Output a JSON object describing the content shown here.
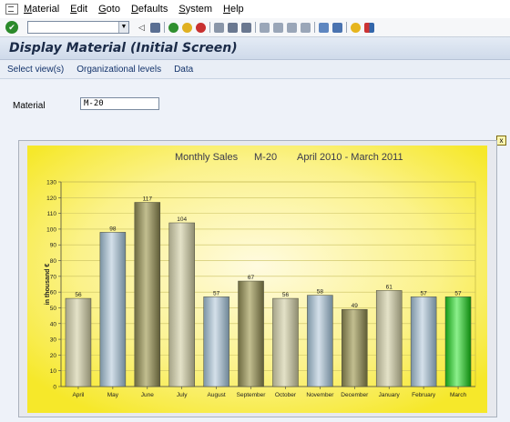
{
  "menu": {
    "items": [
      "Material",
      "Edit",
      "Goto",
      "Defaults",
      "System",
      "Help"
    ],
    "underlines": [
      "M",
      "E",
      "G",
      "D",
      "S",
      "H"
    ]
  },
  "toolbar": {
    "command_value": "",
    "icons": [
      "enter-icon",
      "back-icon",
      "exit-icon",
      "cancel-icon",
      "save-icon",
      "print-icon",
      "find-icon",
      "find-next-icon",
      "first-page-icon",
      "prev-page-icon",
      "next-page-icon",
      "last-page-icon",
      "create-session-icon",
      "shortcut-icon",
      "help-icon",
      "layout-icon"
    ]
  },
  "title": "Display Material (Initial Screen)",
  "appbar": {
    "select_views": "Select view(s)",
    "org_levels": "Organizational levels",
    "data": "Data"
  },
  "form": {
    "material_label": "Material",
    "material_value": "M-20"
  },
  "closebox": "x",
  "chart_data": {
    "type": "bar",
    "title_parts": [
      "Monthly Sales",
      "M-20",
      "April 2010 - March 2011"
    ],
    "ylabel": "in thousand €",
    "xlabel": "",
    "ylim": [
      0,
      130
    ],
    "yticks": [
      0,
      10,
      20,
      30,
      40,
      50,
      60,
      70,
      80,
      90,
      100,
      110,
      120,
      130
    ],
    "grid": true,
    "legend": "none",
    "categories": [
      "April",
      "May",
      "June",
      "July",
      "August",
      "September",
      "October",
      "November",
      "December",
      "January",
      "February",
      "March"
    ],
    "values": [
      56,
      98,
      117,
      104,
      57,
      67,
      56,
      58,
      49,
      61,
      57,
      57
    ],
    "bar_styles": [
      "khaki",
      "steel",
      "olive",
      "khaki",
      "steel",
      "olive",
      "khaki",
      "steel",
      "olive",
      "khaki",
      "steel",
      "green"
    ]
  }
}
